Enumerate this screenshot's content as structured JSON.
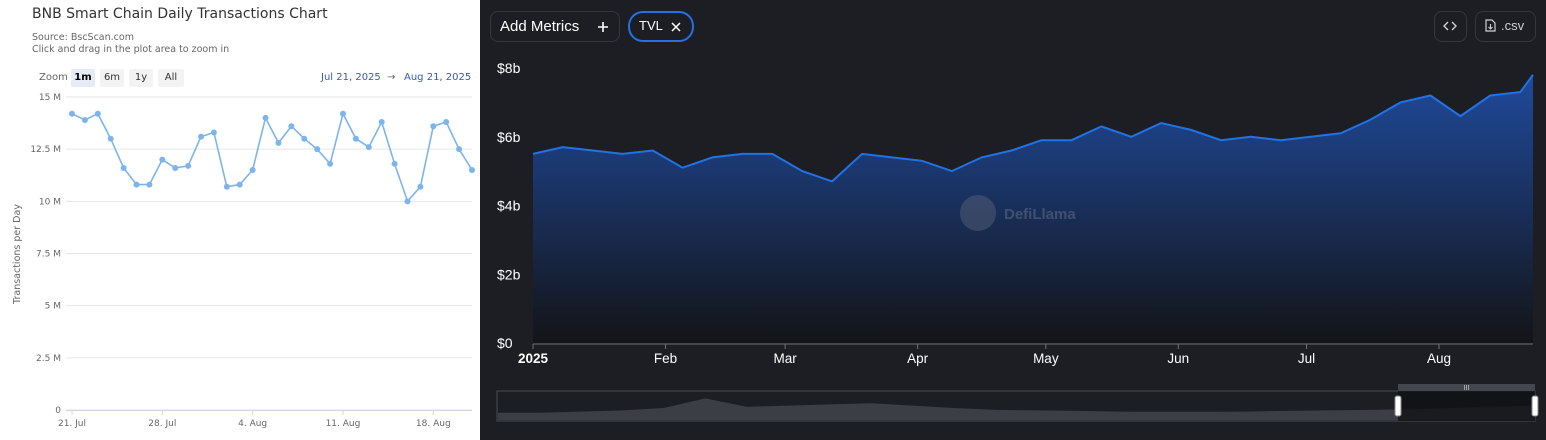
{
  "left_chart": {
    "title": "BNB Smart Chain Daily Transactions Chart",
    "source": "Source: BscScan.com",
    "hint": "Click and drag in the plot area to zoom in",
    "zoom_label": "Zoom",
    "zoom_buttons": [
      "1m",
      "6m",
      "1y",
      "All"
    ],
    "selected_zoom": "1m",
    "range_from": "Jul 21, 2025",
    "range_arrow": "→",
    "range_to": "Aug 21, 2025",
    "line_color": "#7cb5ec"
  },
  "right_panel": {
    "add_metrics_label": "Add Metrics",
    "add_icon": "plus-icon",
    "metric_chip": "TVL",
    "chip_icon": "close-icon",
    "embed_icon": "code-icon",
    "csv_icon": "file-download-icon",
    "csv_label": ".csv",
    "watermark": "DefiLlama",
    "accent_color": "#2172e5",
    "navigator_handle_label": "III"
  },
  "chart_data": [
    {
      "type": "line",
      "title": "BNB Smart Chain Daily Transactions Chart",
      "ylabel": "Transactions per Day",
      "xlabel": "",
      "x": [
        "Jul 21",
        "Jul 22",
        "Jul 23",
        "Jul 24",
        "Jul 25",
        "Jul 26",
        "Jul 27",
        "Jul 28",
        "Jul 29",
        "Jul 30",
        "Jul 31",
        "Aug 1",
        "Aug 2",
        "Aug 3",
        "Aug 4",
        "Aug 5",
        "Aug 6",
        "Aug 7",
        "Aug 8",
        "Aug 9",
        "Aug 10",
        "Aug 11",
        "Aug 12",
        "Aug 13",
        "Aug 14",
        "Aug 15",
        "Aug 16",
        "Aug 17",
        "Aug 18",
        "Aug 19",
        "Aug 20",
        "Aug 21"
      ],
      "values": [
        14.2,
        13.9,
        14.2,
        13.0,
        11.6,
        10.8,
        10.8,
        12.0,
        11.6,
        11.7,
        13.1,
        13.3,
        10.7,
        10.8,
        11.5,
        14.0,
        12.8,
        13.6,
        13.0,
        12.5,
        11.8,
        14.2,
        13.0,
        12.6,
        13.8,
        11.8,
        10.0,
        10.7,
        13.6,
        13.8,
        12.5,
        11.5
      ],
      "yticks": [
        "0",
        "2.5 M",
        "5 M",
        "7.5 M",
        "10 M",
        "12.5 M",
        "15 M"
      ],
      "ylim": [
        0,
        15
      ],
      "xticks": [
        "21. Jul",
        "28. Jul",
        "4. Aug",
        "11. Aug",
        "18. Aug"
      ],
      "grid": true,
      "legend": "none"
    },
    {
      "type": "area",
      "title": "",
      "series": [
        {
          "name": "TVL",
          "x": [
            "2025-01-01",
            "2025-01-08",
            "2025-01-15",
            "2025-01-22",
            "2025-01-29",
            "2025-02-05",
            "2025-02-12",
            "2025-02-19",
            "2025-02-26",
            "2025-03-05",
            "2025-03-12",
            "2025-03-19",
            "2025-03-26",
            "2025-04-02",
            "2025-04-09",
            "2025-04-16",
            "2025-04-23",
            "2025-04-30",
            "2025-05-07",
            "2025-05-14",
            "2025-05-21",
            "2025-05-28",
            "2025-06-04",
            "2025-06-11",
            "2025-06-18",
            "2025-06-25",
            "2025-07-02",
            "2025-07-09",
            "2025-07-16",
            "2025-07-23",
            "2025-07-30",
            "2025-08-06",
            "2025-08-13",
            "2025-08-20",
            "2025-08-23"
          ],
          "values": [
            5.5,
            5.7,
            5.6,
            5.5,
            5.6,
            5.1,
            5.4,
            5.5,
            5.5,
            5.0,
            4.7,
            5.5,
            5.4,
            5.3,
            5.0,
            5.4,
            5.6,
            5.9,
            5.9,
            6.3,
            6.0,
            6.4,
            6.2,
            5.9,
            6.0,
            5.9,
            6.0,
            6.1,
            6.5,
            7.0,
            7.2,
            6.6,
            7.2,
            7.3,
            7.8
          ]
        }
      ],
      "yticks": [
        "$0",
        "$2b",
        "$4b",
        "$6b",
        "$8b"
      ],
      "ylim": [
        0,
        8
      ],
      "xticks": [
        "2025",
        "Feb",
        "Mar",
        "Apr",
        "May",
        "Jun",
        "Jul",
        "Aug"
      ],
      "grid": false,
      "legend": "none"
    }
  ]
}
